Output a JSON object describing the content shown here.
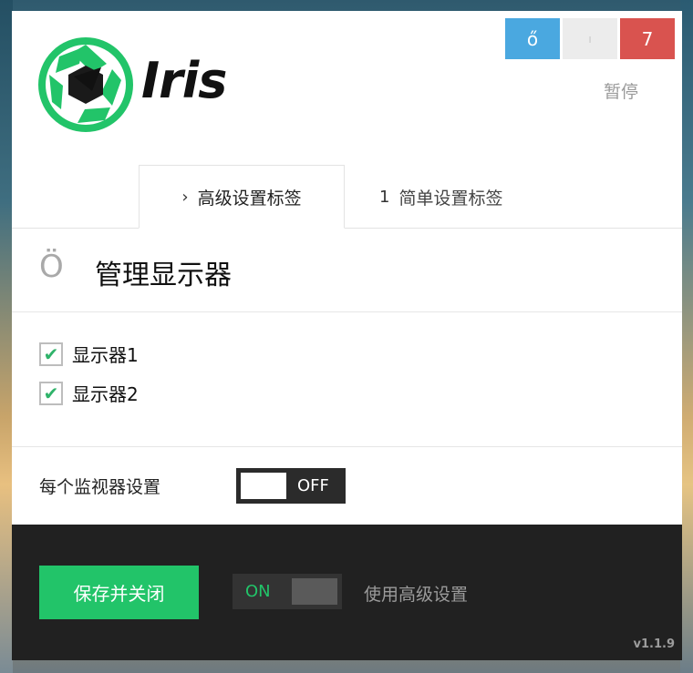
{
  "window_controls": {
    "blue_button_label": "ő",
    "gray_button_label": "ı",
    "red_button_label": "7",
    "pause_label": "暂停"
  },
  "brand": {
    "name": "Iris",
    "logo_icon": "camera-aperture-icon",
    "color": "#22c469"
  },
  "tabs": [
    {
      "icon": "›",
      "label": "高级设置标签",
      "active": true
    },
    {
      "icon": "1",
      "label": "简单设置标签",
      "active": false
    }
  ],
  "section": {
    "icon": "Ö",
    "title": "管理显示器"
  },
  "monitors": [
    {
      "label": "显示器1",
      "checked": true
    },
    {
      "label": "显示器2",
      "checked": true
    }
  ],
  "per_monitor": {
    "label": "每个监视器设置",
    "toggle_text": "OFF",
    "state": "off"
  },
  "footer": {
    "save_label": "保存并关闭",
    "advanced_toggle_text": "ON",
    "advanced_label": "使用高级设置",
    "version": "v1.1.9"
  },
  "colors": {
    "accent_green": "#22c469",
    "button_blue": "#4aa8e0",
    "button_red": "#d9534f",
    "footer_bg": "#212121"
  }
}
